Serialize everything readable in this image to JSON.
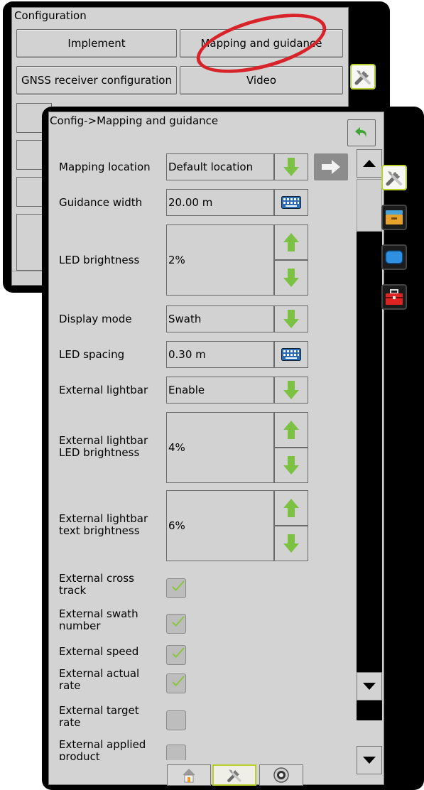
{
  "background_panel": {
    "title": "Configuration",
    "buttons": [
      {
        "label": "Implement"
      },
      {
        "label": "Mapping and guidance"
      },
      {
        "label": "GNSS receiver configuration"
      },
      {
        "label": "Video"
      }
    ],
    "highlight_color": "#d8232a"
  },
  "front_panel": {
    "title": "Config->Mapping and guidance",
    "back_icon": "back-arrow-icon",
    "settings": [
      {
        "label": "Mapping location",
        "value": "Default location",
        "control": "dropdown"
      },
      {
        "label": "Guidance width",
        "value": "20.00 m",
        "control": "keyboard"
      },
      {
        "label": "LED brightness",
        "value": "2%",
        "control": "stepper"
      },
      {
        "label": "Display mode",
        "value": "Swath",
        "control": "dropdown"
      },
      {
        "label": "LED spacing",
        "value": "0.30 m",
        "control": "keyboard"
      },
      {
        "label": "External lightbar",
        "value": "Enable",
        "control": "dropdown"
      },
      {
        "label": "External lightbar LED brightness",
        "value": "4%",
        "control": "stepper"
      },
      {
        "label": "External lightbar text brightness",
        "value": "6%",
        "control": "stepper"
      },
      {
        "label": "External cross track",
        "checked": true
      },
      {
        "label": "External swath number",
        "checked": true
      },
      {
        "label": "External speed",
        "checked": true
      },
      {
        "label": "External actual rate",
        "checked": true
      },
      {
        "label": "External target rate",
        "checked": false
      },
      {
        "label": "External applied product",
        "checked": false
      }
    ]
  },
  "side_tabs": [
    "tools-icon",
    "console-icon",
    "display-icon",
    "toolbox-icon"
  ],
  "bottom_nav": [
    "home-icon",
    "tools-icon",
    "dial-icon"
  ],
  "colors": {
    "accent_green": "#8cc63f",
    "active_border": "#b8cf2c",
    "panel_gray": "#d3d3d3"
  }
}
